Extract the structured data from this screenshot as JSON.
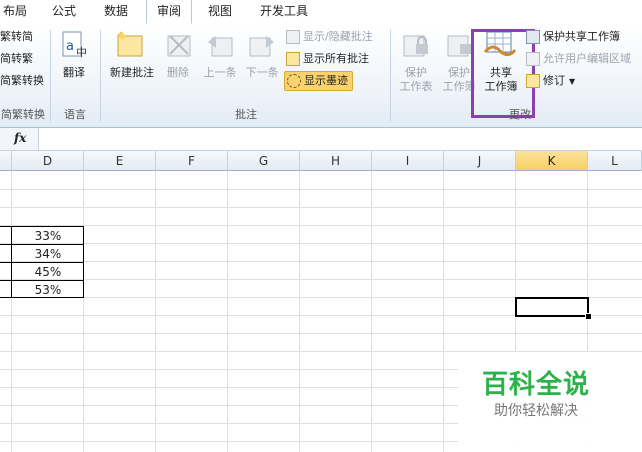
{
  "tabs": {
    "layout": "布局",
    "formulas": "公式",
    "data": "数据",
    "review": "审阅",
    "view": "视图",
    "developer": "开发工具"
  },
  "chinese_conversion": {
    "to_simplified": "繁转简",
    "to_traditional": "简转繁",
    "convert": "简繁转换",
    "group_label": "简繁转换"
  },
  "language": {
    "translate": "翻译",
    "group_label": "语言"
  },
  "comments": {
    "new_comment": "新建批注",
    "delete": "删除",
    "previous": "上一条",
    "next": "下一条",
    "show_hide": "显示/隐藏批注",
    "show_all": "显示所有批注",
    "show_ink": "显示墨迹",
    "group_label": "批注"
  },
  "changes": {
    "protect_sheet_1": "保护",
    "protect_sheet_2": "工作表",
    "protect_workbook_1": "保护",
    "protect_workbook_2": "工作簿",
    "share_1": "共享",
    "share_2": "工作簿",
    "protect_share": "保护共享工作簿",
    "allow_edit": "允许用户编辑区域",
    "track_changes": "修订",
    "group_label": "更改"
  },
  "formula_bar": {
    "fx": "fx"
  },
  "columns": [
    "D",
    "E",
    "F",
    "G",
    "H",
    "I",
    "J",
    "K",
    "L"
  ],
  "selected_column": "K",
  "cells": {
    "d1": "33%",
    "d2": "34%",
    "d3": "45%",
    "d4": "53%"
  },
  "watermark": {
    "title": "百科全说",
    "subtitle": "助你轻松解决"
  },
  "colors": {
    "highlight": "#8b3fb0",
    "ink_button": "#f8d36b",
    "selected_header": "#f8cf63"
  }
}
